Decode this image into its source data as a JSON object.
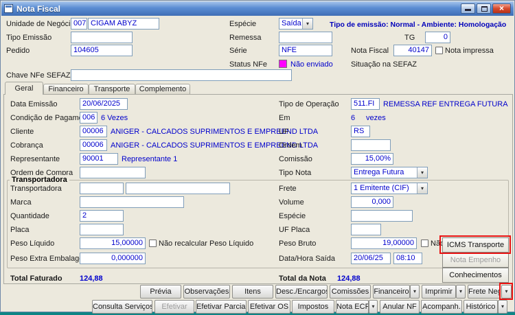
{
  "window": {
    "title": "Nota Fiscal"
  },
  "icons": {
    "close": "×",
    "dropdown": "▾"
  },
  "top": {
    "unidade": {
      "label": "Unidade de Negócio",
      "code": "007",
      "name": "CIGAM ABYZ"
    },
    "especie": {
      "label": "Espécie",
      "value": "Saída"
    },
    "emissao_info": "Tipo de emissão: Normal - Ambiente: Homologação",
    "tipo_emissao": {
      "label": "Tipo Emissão",
      "value": ""
    },
    "remessa": {
      "label": "Remessa",
      "value": ""
    },
    "tg": {
      "label": "TG",
      "value": "0"
    },
    "pedido": {
      "label": "Pedido",
      "value": "104605"
    },
    "serie": {
      "label": "Série",
      "value": "NFE"
    },
    "nota_fiscal": {
      "label": "Nota Fiscal",
      "value": "40147"
    },
    "nota_impressa": {
      "label": "Nota impressa",
      "checked": false
    },
    "status_nfe": {
      "label": "Status NFe",
      "value": "Não enviado",
      "swatch_color": "#ff00ff"
    },
    "situacao_sefaz": {
      "label": "Situação na SEFAZ"
    },
    "chave_nfe": {
      "label": "Chave NFe SEFAZ",
      "value": ""
    }
  },
  "tabs": [
    {
      "label": "Geral",
      "active": true
    },
    {
      "label": "Financeiro",
      "active": false
    },
    {
      "label": "Transporte",
      "active": false
    },
    {
      "label": "Complemento",
      "active": false
    }
  ],
  "geral": {
    "data_emissao": {
      "label": "Data Emissão",
      "value": "20/06/2025"
    },
    "tipo_operacao": {
      "label": "Tipo de Operação",
      "code": "511.FI",
      "desc": "REMESSA REF ENTREGA FUTURA"
    },
    "condicao_pagamento": {
      "label": "Condição de Pagamento",
      "code": "006",
      "desc": "6 Vezes"
    },
    "em": {
      "label": "Em",
      "value": "6",
      "suffix": "vezes"
    },
    "cliente": {
      "label": "Cliente",
      "code": "00006",
      "desc": "ANIGER - CALCADOS SUPRIMENTOS E EMPREEND LTDA"
    },
    "uf": {
      "label": "UF",
      "value": "RS"
    },
    "cobranca": {
      "label": "Cobrança",
      "code": "00006",
      "desc": "ANIGER - CALCADOS SUPRIMENTOS E EMPREEND LTDA"
    },
    "ordem": {
      "label": "Ordem",
      "value": ""
    },
    "representante": {
      "label": "Representante",
      "code": "90001",
      "desc": "Representante 1"
    },
    "comissao": {
      "label": "Comissão",
      "value": "15,00%"
    },
    "ordem_compra": {
      "label": "Ordem de Compra",
      "value": ""
    },
    "tipo_nota": {
      "label": "Tipo Nota",
      "value": "Entrega Futura"
    }
  },
  "transportadora": {
    "group_label": "Transportadora",
    "transportadora": {
      "label": "Transportadora",
      "code": "",
      "name": ""
    },
    "frete": {
      "label": "Frete",
      "value": "1 Emitente (CIF)"
    },
    "marca": {
      "label": "Marca",
      "value": ""
    },
    "volume": {
      "label": "Volume",
      "value": "0,000"
    },
    "quantidade": {
      "label": "Quantidade",
      "value": "2"
    },
    "especie": {
      "label": "Espécie",
      "value": ""
    },
    "placa": {
      "label": "Placa",
      "value": ""
    },
    "uf_placa": {
      "label": "UF Placa",
      "value": ""
    },
    "peso_liquido": {
      "label": "Peso Líquido",
      "value": "15,00000",
      "checkbox_label": "Não recalcular Peso Líquido",
      "checked": false
    },
    "peso_bruto": {
      "label": "Peso Bruto",
      "value": "19,00000",
      "checkbox_label": "Não recalc",
      "checked": false
    },
    "peso_extra": {
      "label": "Peso Extra Embalagem",
      "value": "0,000000"
    },
    "data_saida": {
      "label": "Data/Hora Saída",
      "date": "20/06/25",
      "time": "08:10"
    }
  },
  "popup_menu": {
    "items": [
      {
        "label": "ICMS Transporte",
        "disabled": false,
        "highlighted": true
      },
      {
        "label": "Nota Empenho",
        "disabled": true,
        "highlighted": false
      },
      {
        "label": "Conhecimentos",
        "disabled": false,
        "highlighted": false
      }
    ]
  },
  "totals": {
    "faturado_label": "Total Faturado",
    "faturado_value": "124,88",
    "nota_label": "Total da Nota",
    "nota_value": "124,88"
  },
  "actions": {
    "row1": [
      {
        "label": "Prévia"
      },
      {
        "label": "Observações"
      },
      {
        "label": "Itens"
      },
      {
        "label": "Desc./Encargos"
      },
      {
        "label": "Comissões"
      },
      {
        "label": "Financeiro",
        "split": true
      },
      {
        "label": "Imprimir",
        "split": true
      },
      {
        "label": "Frete Neg.",
        "split": true
      }
    ],
    "row2": [
      {
        "label": "Consulta Serviços"
      },
      {
        "label": "Efetivar",
        "disabled": true
      },
      {
        "label": "Efetivar Parcial"
      },
      {
        "label": "Efetivar OS"
      },
      {
        "label": "Impostos"
      },
      {
        "label": "Nota ECF",
        "split": true
      },
      {
        "label": "Anular NF"
      },
      {
        "label": "Acompanh."
      },
      {
        "label": "Histórico",
        "split": true
      }
    ]
  }
}
